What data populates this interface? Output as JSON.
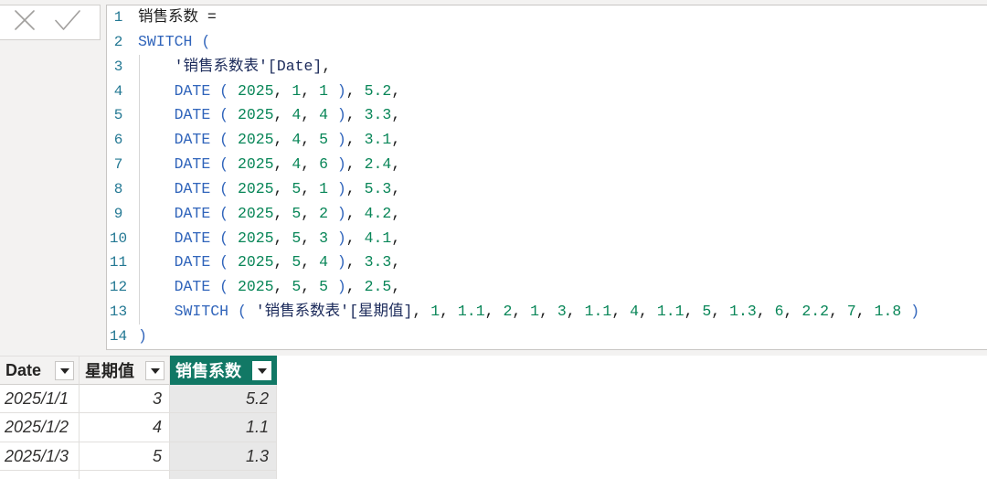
{
  "theme": {
    "page_background": "#f3f2f1",
    "line_number_color": "#237893",
    "text_color": "#1f1f1f",
    "function_color": "#3165bb",
    "number_color": "#098658",
    "reference_color": "#1b2a5a",
    "selected_header_color": "#117865",
    "selected_column_fill": "#e8e8e8"
  },
  "formula_bar": {
    "cancel_button": {
      "icon": "close-icon"
    },
    "commit_button": {
      "icon": "check-icon"
    },
    "lines": [
      {
        "number": "1",
        "code": "销售系数 ="
      },
      {
        "number": "2",
        "code": "SWITCH ("
      },
      {
        "number": "3",
        "code": "    '销售系数表'[Date],"
      },
      {
        "number": "4",
        "code": "    DATE ( 2025, 1, 1 ), 5.2,"
      },
      {
        "number": "5",
        "code": "    DATE ( 2025, 4, 4 ), 3.3,"
      },
      {
        "number": "6",
        "code": "    DATE ( 2025, 4, 5 ), 3.1,"
      },
      {
        "number": "7",
        "code": "    DATE ( 2025, 4, 6 ), 2.4,"
      },
      {
        "number": "8",
        "code": "    DATE ( 2025, 5, 1 ), 5.3,"
      },
      {
        "number": "9",
        "code": "    DATE ( 2025, 5, 2 ), 4.2,"
      },
      {
        "number": "10",
        "code": "    DATE ( 2025, 5, 3 ), 4.1,"
      },
      {
        "number": "11",
        "code": "    DATE ( 2025, 5, 4 ), 3.3,"
      },
      {
        "number": "12",
        "code": "    DATE ( 2025, 5, 5 ), 2.5,"
      },
      {
        "number": "13",
        "code": "    SWITCH ( '销售系数表'[星期值], 1, 1.1, 2, 1, 3, 1.1, 4, 1.1, 5, 1.3, 6, 2.2, 7, 1.8 )"
      },
      {
        "number": "14",
        "code": ")"
      }
    ]
  },
  "table": {
    "columns": [
      {
        "label": "Date",
        "menu_icon": "dropdown-arrow-icon"
      },
      {
        "label": "星期值",
        "menu_icon": "dropdown-arrow-icon"
      },
      {
        "label": "销售系数",
        "menu_icon": "dropdown-arrow-icon",
        "selected": true
      }
    ],
    "rows": [
      [
        "2025/1/1",
        "3",
        "5.2"
      ],
      [
        "2025/1/2",
        "4",
        "1.1"
      ],
      [
        "2025/1/3",
        "5",
        "1.3"
      ]
    ]
  }
}
